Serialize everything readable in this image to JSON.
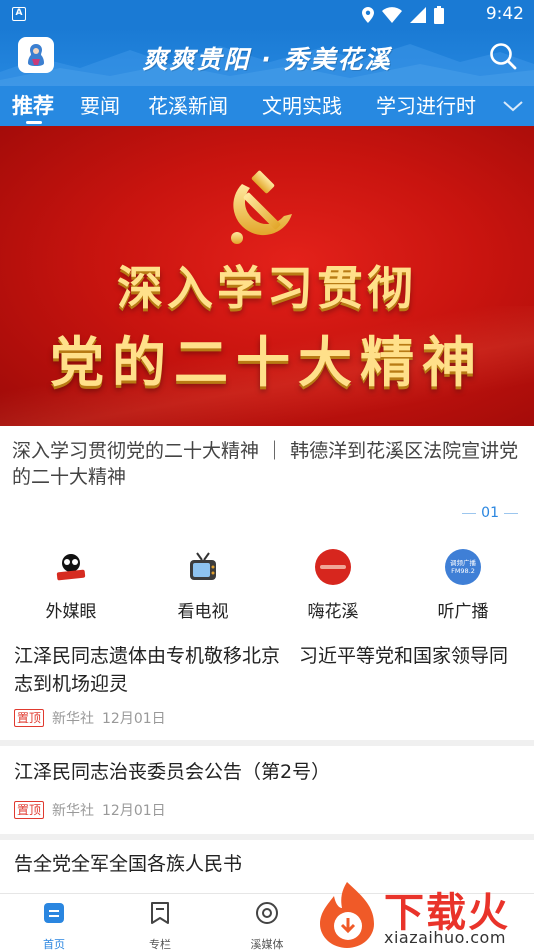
{
  "status_bar": {
    "time": "9:42",
    "app_mark": "A"
  },
  "header": {
    "title": "爽爽贵阳 · 秀美花溪"
  },
  "tabs": [
    {
      "label": "推荐",
      "active": true
    },
    {
      "label": "要闻"
    },
    {
      "label": "花溪新闻"
    },
    {
      "label": "文明实践"
    },
    {
      "label": "学习进行时"
    }
  ],
  "banner": {
    "line1": "深入学习贯彻",
    "line2": "党的二十大精神",
    "caption": "深入学习贯彻党的二十大精神 ｜ 韩德洋到花溪区法院宣讲党的二十大精神",
    "page_indicator": "01"
  },
  "quick_entries": [
    {
      "label": "外媒眼",
      "icon": "foreign-media-icon"
    },
    {
      "label": "看电视",
      "icon": "tv-icon"
    },
    {
      "label": "嗨花溪",
      "icon": "hi-huaxi-icon"
    },
    {
      "label": "听广播",
      "icon": "radio-icon",
      "icon_text": "调频广播 FM98.2"
    }
  ],
  "news": [
    {
      "title": "江泽民同志遗体由专机敬移北京　习近平等党和国家领导同志到机场迎灵",
      "tag": "置顶",
      "source": "新华社",
      "date": "12月01日"
    },
    {
      "title": "江泽民同志治丧委员会公告（第2号）",
      "tag": "置顶",
      "source": "新华社",
      "date": "12月01日"
    },
    {
      "title": "告全党全军全国各族人民书"
    }
  ],
  "bottom_nav": [
    {
      "label": "首页",
      "icon": "home-icon",
      "active": true
    },
    {
      "label": "专栏",
      "icon": "bookmark-icon"
    },
    {
      "label": "溪媒体",
      "icon": "media-icon"
    }
  ],
  "watermark": {
    "text": "下载火",
    "url": "xiazaihuo.com"
  },
  "colors": {
    "primary": "#1a7ad4",
    "banner_red": "#c9140f",
    "accent_red": "#e03a2f"
  }
}
